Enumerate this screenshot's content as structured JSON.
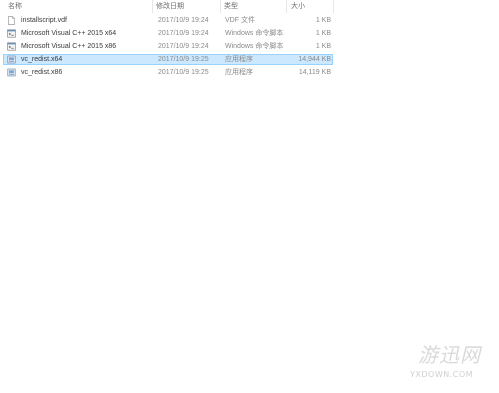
{
  "columns": {
    "name": "名称",
    "modified": "修改日期",
    "type": "类型",
    "size": "大小"
  },
  "files": [
    {
      "name": "installscript.vdf",
      "modified": "2017/10/9 19:24",
      "type": "VDF 文件",
      "size": "1 KB",
      "icon": "document-icon",
      "selected": false
    },
    {
      "name": "Microsoft Visual C++ 2015 x64",
      "modified": "2017/10/9 19:24",
      "type": "Windows 命令脚本",
      "size": "1 KB",
      "icon": "script-icon",
      "selected": false
    },
    {
      "name": "Microsoft Visual C++ 2015 x86",
      "modified": "2017/10/9 19:24",
      "type": "Windows 命令脚本",
      "size": "1 KB",
      "icon": "script-icon",
      "selected": false
    },
    {
      "name": "vc_redist.x64",
      "modified": "2017/10/9 19:25",
      "type": "应用程序",
      "size": "14,944 KB",
      "icon": "installer-icon",
      "selected": true
    },
    {
      "name": "vc_redist.x86",
      "modified": "2017/10/9 19:25",
      "type": "应用程序",
      "size": "14,119 KB",
      "icon": "installer-icon",
      "selected": false
    }
  ],
  "watermark": {
    "main": "游迅网",
    "sub": "YXDOWN.COM"
  },
  "colors": {
    "selection_bg": "#cce8ff",
    "selection_border": "#99d1ff"
  }
}
